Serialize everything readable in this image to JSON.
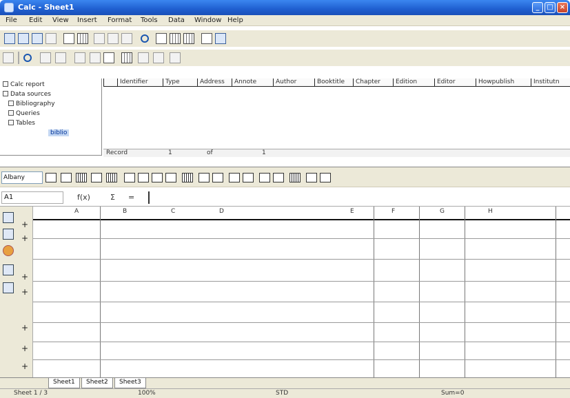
{
  "window": {
    "title": "Calc - Sheet1",
    "buttons": [
      "_",
      "□",
      "×"
    ]
  },
  "menu": [
    "File",
    "Edit",
    "View",
    "Insert",
    "Format",
    "Tools",
    "Data",
    "Window",
    "Help"
  ],
  "tree": {
    "items": [
      "Calc report",
      "Data sources",
      "Bibliography",
      "Queries",
      "Tables",
      "biblio"
    ],
    "selected": "biblio"
  },
  "top_grid": {
    "columns": [
      "",
      "Identifier",
      "Type",
      "Address",
      "Annote",
      "Author",
      "Booktitle",
      "Chapter",
      "Edition",
      "Editor",
      "Howpublish",
      "Institutn"
    ]
  },
  "top_hscroll": {
    "left": "Record",
    "mid1": "1",
    "mid2": "of",
    "right": "1"
  },
  "format_bar": {
    "font": "Albany"
  },
  "formula_bar": {
    "cell_ref": "A1",
    "fx": "f(x)",
    "sum": "Σ",
    "eq": "=",
    "value": ""
  },
  "sheet": {
    "columns": [
      "A",
      "B",
      "C",
      "D",
      "E",
      "F",
      "G",
      "H"
    ]
  },
  "sheet_tabs": {
    "tabs": [
      "Sheet1",
      "Sheet2",
      "Sheet3"
    ],
    "active": "Sheet1"
  },
  "status": {
    "sheet": "Sheet 1 / 3",
    "zoom": "100%",
    "mode": "STD",
    "sum": "Sum=0"
  }
}
